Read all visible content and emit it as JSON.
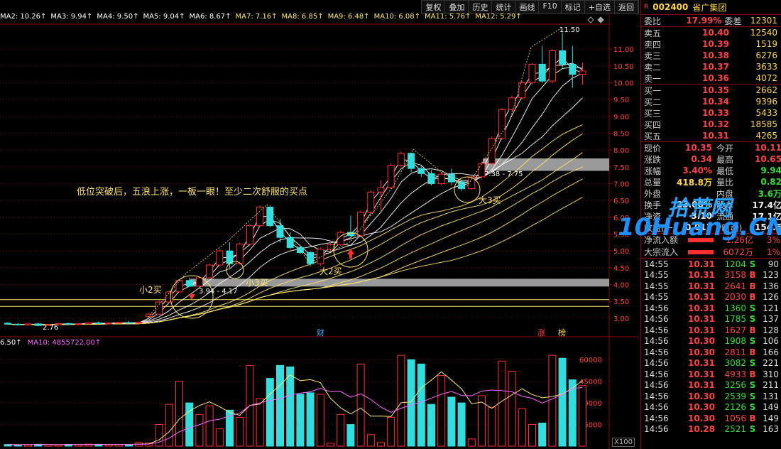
{
  "toolbar": [
    "复权",
    "叠加",
    "历史",
    "统计",
    "画线",
    "F10",
    "标记",
    "+自选",
    "返回"
  ],
  "ma_legend": [
    {
      "text": "MA2: 10.26↑",
      "color": "#ffffff"
    },
    {
      "text": "MA3: 9.94↑",
      "color": "#ffffff"
    },
    {
      "text": "MA4: 9.50↑",
      "color": "#ffffff"
    },
    {
      "text": "MA5: 9.04↑",
      "color": "#ffffff"
    },
    {
      "text": "MA6: 8.67↑",
      "color": "#ffffff"
    },
    {
      "text": "MA7: 7.16↑",
      "color": "#ffe66e"
    },
    {
      "text": "MA8: 6.85↑",
      "color": "#ffe66e"
    },
    {
      "text": "MA9: 6.48↑",
      "color": "#ffe66e"
    },
    {
      "text": "MA10: 6.08↑",
      "color": "#ffe66e"
    },
    {
      "text": "MA11: 5.76↑",
      "color": "#ffe66e"
    },
    {
      "text": "MA12: 5.29↑",
      "color": "#ffe66e"
    }
  ],
  "vol_legend": [
    {
      "text": "6.50↑",
      "color": "#ffffff"
    },
    {
      "text": "MA10: 4855722.00↑",
      "color": "#ff66ff"
    }
  ],
  "annotation": "低位突破后，五浪上涨，一板一眼！至少二次舒服的买点",
  "labels": {
    "small2": "小2买",
    "small3": "小3买",
    "big2": "大2买",
    "big3": "大3买",
    "range1": "3.94 - 4.17",
    "range2": "7.38 - 7.75",
    "high": "11.50",
    "low": "2.76",
    "cai": "财",
    "zhang": "涨",
    "bang": "榜",
    "x100": "X100"
  },
  "price_axis": [
    "11.00",
    "10.50",
    "10.00",
    "9.50",
    "9.00",
    "8.50",
    "8.00",
    "7.50",
    "7.00",
    "6.50",
    "6.00",
    "5.50",
    "5.00",
    "4.50",
    "4.00",
    "3.50",
    "3.00"
  ],
  "vol_axis": [
    "60000",
    "45000",
    "30000",
    "15000"
  ],
  "colors": {
    "up": "#ff3030",
    "down": "#33dddd",
    "ma_short": "#ffffff",
    "ma_long": "#ffe66e",
    "panel_border": "#8b0000"
  },
  "stock": {
    "code": "002400",
    "name": "省广集团",
    "flag": "R"
  },
  "order_ratio": {
    "label": "委比",
    "value": "17.99%",
    "diff_label": "委差",
    "diff": "12301"
  },
  "asks": [
    {
      "label": "卖五",
      "price": "10.40",
      "vol": "12540"
    },
    {
      "label": "卖四",
      "price": "10.39",
      "vol": "1519"
    },
    {
      "label": "卖三",
      "price": "10.38",
      "vol": "6276"
    },
    {
      "label": "卖二",
      "price": "10.37",
      "vol": "3633"
    },
    {
      "label": "卖一",
      "price": "10.36",
      "vol": "4072"
    }
  ],
  "bids": [
    {
      "label": "买一",
      "price": "10.35",
      "vol": "2662"
    },
    {
      "label": "买二",
      "price": "10.34",
      "vol": "9396"
    },
    {
      "label": "买三",
      "price": "10.33",
      "vol": "5433"
    },
    {
      "label": "买四",
      "price": "10.32",
      "vol": "18585"
    },
    {
      "label": "买五",
      "price": "10.31",
      "vol": "4265"
    }
  ],
  "quote": [
    {
      "k": "现价",
      "v": "10.35",
      "k2": "今开",
      "v2": "10.11",
      "c1": "red",
      "c2": "red"
    },
    {
      "k": "涨跌",
      "v": "0.34",
      "k2": "最高",
      "v2": "10.65",
      "c1": "red",
      "c2": "red"
    },
    {
      "k": "涨幅",
      "v": "3.40%",
      "k2": "最低",
      "v2": "9.94",
      "c1": "red",
      "c2": "green"
    },
    {
      "k": "总量",
      "v": "418.8万",
      "k2": "量比",
      "v2": "0.82",
      "c1": "yellow",
      "c2": "green"
    },
    {
      "k": "外盘",
      "v": "",
      "k2": "内盘",
      "v2": "3.6万",
      "c1": "red",
      "c2": "green"
    },
    {
      "k": "换手",
      "v": "23.00%",
      "k2": "股本",
      "v2": "17.4亿",
      "c1": "white",
      "c2": "white"
    },
    {
      "k": "净资",
      "v": "3.10",
      "k2": "流通",
      "v2": "17.1亿",
      "c1": "white",
      "c2": "white"
    },
    {
      "k": "收益(一)",
      "v": "0.013",
      "k2": "PE(动)",
      "v2": "154.5",
      "c1": "white",
      "c2": "white"
    }
  ],
  "flows": [
    {
      "k": "净流入额",
      "v": "1.26亿",
      "p": "3%"
    },
    {
      "k": "大宗流入",
      "v": "6072万",
      "p": "1%"
    }
  ],
  "ticks": [
    {
      "t": "14:55",
      "p": "10.31",
      "v": "1204",
      "s": "S",
      "n": "90"
    },
    {
      "t": "14:55",
      "p": "10.31",
      "v": "3158",
      "s": "B",
      "n": "123"
    },
    {
      "t": "14:55",
      "p": "10.31",
      "v": "2641",
      "s": "B",
      "n": "136"
    },
    {
      "t": "14:55",
      "p": "10.31",
      "v": "2030",
      "s": "B",
      "n": "126"
    },
    {
      "t": "14:56",
      "p": "10.31",
      "v": "1360",
      "s": "S",
      "n": "121"
    },
    {
      "t": "14:56",
      "p": "10.31",
      "v": "1785",
      "s": "S",
      "n": "137"
    },
    {
      "t": "14:56",
      "p": "10.31",
      "v": "1627",
      "s": "B",
      "n": "128"
    },
    {
      "t": "14:56",
      "p": "10.30",
      "v": "1908",
      "s": "S",
      "n": "106"
    },
    {
      "t": "14:56",
      "p": "10.30",
      "v": "2811",
      "s": "B",
      "n": "166"
    },
    {
      "t": "14:56",
      "p": "10.31",
      "v": "3082",
      "s": "S",
      "n": "221"
    },
    {
      "t": "14:56",
      "p": "10.31",
      "v": "4933",
      "s": "B",
      "n": "310"
    },
    {
      "t": "14:56",
      "p": "10.31",
      "v": "3256",
      "s": "S",
      "n": "211"
    },
    {
      "t": "14:56",
      "p": "10.30",
      "v": "2539",
      "s": "S",
      "n": "131"
    },
    {
      "t": "14:56",
      "p": "10.30",
      "v": "2126",
      "s": "S",
      "n": "149"
    },
    {
      "t": "14:56",
      "p": "10.30",
      "v": "1056",
      "s": "B",
      "n": "149"
    },
    {
      "t": "14:56",
      "p": "10.28",
      "v": "2521",
      "s": "S",
      "n": "163"
    }
  ],
  "watermark": {
    "top": "拾荒网",
    "bottom": "10Huang.CN"
  },
  "chart_data": {
    "type": "candlestick",
    "candles": [
      [
        2.85,
        2.88,
        2.8,
        2.82
      ],
      [
        2.82,
        2.85,
        2.78,
        2.8
      ],
      [
        2.8,
        2.84,
        2.77,
        2.83
      ],
      [
        2.83,
        2.86,
        2.76,
        2.78
      ],
      [
        2.78,
        2.82,
        2.76,
        2.81
      ],
      [
        2.81,
        2.85,
        2.79,
        2.84
      ],
      [
        2.84,
        2.86,
        2.8,
        2.82
      ],
      [
        2.82,
        2.85,
        2.79,
        2.83
      ],
      [
        2.83,
        2.88,
        2.81,
        2.86
      ],
      [
        2.86,
        2.9,
        2.83,
        2.84
      ],
      [
        2.84,
        2.87,
        2.81,
        2.85
      ],
      [
        2.85,
        2.89,
        2.83,
        2.87
      ],
      [
        2.87,
        2.92,
        2.84,
        2.85
      ],
      [
        2.85,
        2.9,
        2.83,
        2.88
      ],
      [
        3.05,
        3.15,
        3.02,
        3.12
      ],
      [
        3.12,
        3.52,
        3.1,
        3.48
      ],
      [
        3.48,
        3.82,
        3.45,
        3.78
      ],
      [
        3.78,
        4.15,
        3.75,
        4.12
      ],
      [
        4.12,
        4.2,
        3.92,
        3.95
      ],
      [
        3.95,
        4.25,
        3.9,
        4.2
      ],
      [
        4.2,
        4.62,
        4.18,
        4.58
      ],
      [
        4.58,
        5.05,
        4.55,
        5.0
      ],
      [
        5.0,
        5.25,
        4.5,
        4.62
      ],
      [
        4.62,
        5.25,
        4.6,
        5.2
      ],
      [
        5.2,
        5.8,
        5.15,
        5.75
      ],
      [
        5.75,
        6.35,
        5.7,
        6.3
      ],
      [
        6.3,
        6.35,
        5.7,
        5.75
      ],
      [
        5.75,
        5.95,
        5.25,
        5.4
      ],
      [
        5.4,
        5.55,
        5.05,
        5.1
      ],
      [
        5.1,
        5.15,
        4.9,
        4.95
      ],
      [
        4.95,
        5.0,
        4.55,
        4.62
      ],
      [
        4.62,
        5.1,
        4.55,
        5.05
      ],
      [
        5.05,
        5.25,
        4.98,
        5.18
      ],
      [
        5.18,
        5.6,
        5.15,
        5.55
      ],
      [
        5.55,
        6.05,
        5.5,
        5.45
      ],
      [
        5.45,
        6.2,
        5.42,
        6.15
      ],
      [
        6.15,
        6.8,
        6.1,
        6.75
      ],
      [
        6.75,
        7.1,
        6.2,
        6.88
      ],
      [
        6.88,
        7.6,
        6.85,
        7.55
      ],
      [
        7.55,
        7.95,
        7.5,
        7.9
      ],
      [
        7.9,
        7.92,
        7.35,
        7.45
      ],
      [
        7.45,
        7.55,
        7.2,
        7.3
      ],
      [
        7.3,
        7.4,
        6.95,
        7.0
      ],
      [
        7.0,
        7.35,
        6.95,
        7.28
      ],
      [
        7.28,
        7.45,
        6.95,
        7.05
      ],
      [
        7.05,
        7.1,
        6.78,
        6.85
      ],
      [
        6.85,
        7.25,
        6.82,
        7.2
      ],
      [
        7.2,
        7.65,
        7.15,
        7.6
      ],
      [
        7.6,
        8.4,
        7.55,
        8.35
      ],
      [
        8.35,
        9.25,
        8.3,
        9.2
      ],
      [
        9.2,
        9.62,
        9.15,
        9.55
      ],
      [
        9.55,
        10.05,
        9.5,
        10.0
      ],
      [
        10.0,
        10.6,
        9.95,
        10.55
      ],
      [
        10.55,
        11.1,
        10.0,
        10.05
      ],
      [
        10.05,
        11.0,
        9.98,
        10.95
      ],
      [
        10.95,
        11.5,
        10.4,
        10.55
      ],
      [
        10.55,
        11.1,
        9.85,
        10.25
      ],
      [
        10.25,
        10.6,
        9.94,
        10.35
      ]
    ],
    "price_ylim": [
      2.7,
      11.7
    ],
    "volumes": [
      1200,
      900,
      1100,
      1300,
      1000,
      900,
      1200,
      1100,
      1400,
      1300,
      1000,
      1200,
      1100,
      2500,
      2200,
      15000,
      29000,
      45000,
      30000,
      22000,
      28000,
      12000,
      25000,
      20000,
      56000,
      33000,
      47000,
      56000,
      55000,
      36000,
      37000,
      36000,
      2000,
      22000,
      15000,
      57000,
      8000,
      2500,
      20000,
      63000,
      60000,
      57000,
      29000,
      49000,
      34000,
      30000,
      5000,
      35000,
      27000,
      59000,
      52000,
      26000,
      15000,
      16000,
      63000,
      61000,
      46000,
      42000
    ],
    "vol_ylim": [
      0,
      68000
    ]
  }
}
